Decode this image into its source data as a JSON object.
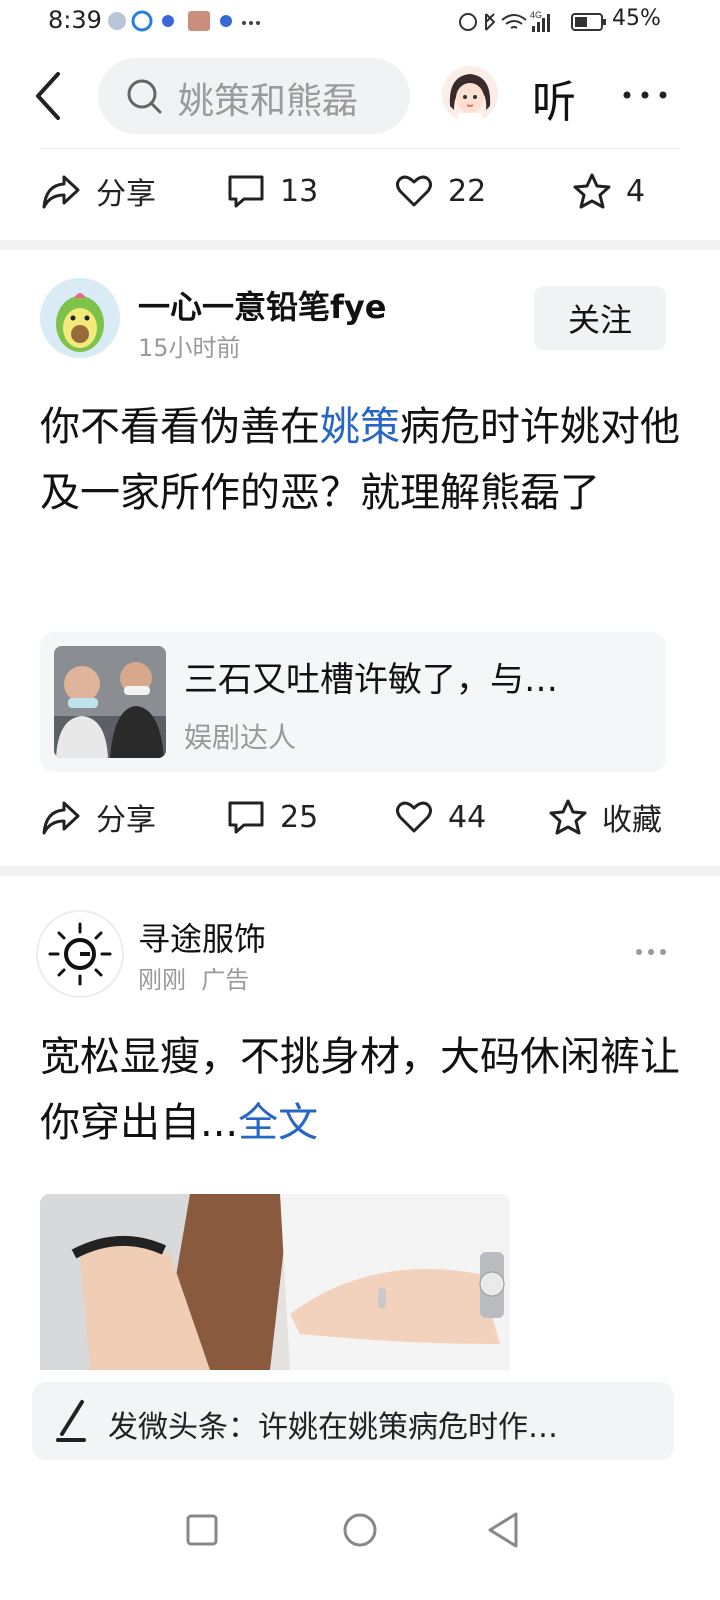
{
  "status_bar": {
    "time": "8:39",
    "battery": "45%",
    "network": "4G"
  },
  "top_bar": {
    "search_text": "姚策和熊磊",
    "listen_label": "听"
  },
  "prev_post_actions": {
    "share_label": "分享",
    "comment_count": "13",
    "like_count": "22",
    "fav_count": "4"
  },
  "post": {
    "author": "一心一意铅笔fye",
    "time": "15小时前",
    "follow_label": "关注",
    "text_before": "你不看看伪善在",
    "text_highlight": "姚策",
    "text_after": "病危时许姚对他及一家所作的恶？就理解熊磊了",
    "card": {
      "title": "三石又吐槽许敏了，与…",
      "source": "娱剧达人"
    },
    "actions": {
      "share_label": "分享",
      "comment_count": "25",
      "like_count": "44",
      "fav_label": "收藏"
    }
  },
  "ad": {
    "name": "寻途服饰",
    "time": "刚刚",
    "tag": "广告",
    "text": "宽松显瘦，不挑身材，大码休闲裤让你穿出自...",
    "full_text_link": "全文"
  },
  "compose": {
    "text": "发微头条：许姚在姚策病危时作…"
  },
  "colors": {
    "link_blue": "#2766c6",
    "muted_gray": "#9a9a9a",
    "chip_bg": "#f1f2f4"
  }
}
